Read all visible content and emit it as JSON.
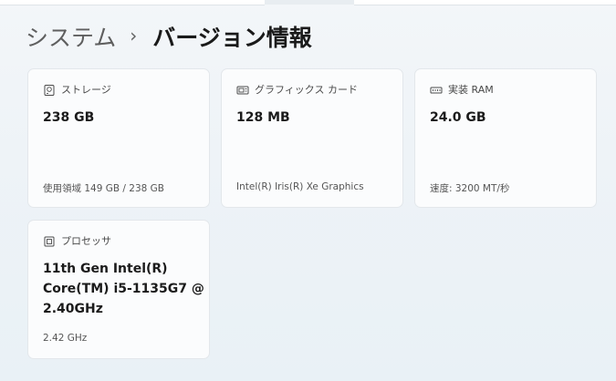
{
  "breadcrumb": {
    "parent": "システム",
    "separator": "›",
    "current": "バージョン情報"
  },
  "cards": {
    "storage": {
      "icon": "storage-icon",
      "label": "ストレージ",
      "value": "238 GB",
      "detail": "使用領域 149 GB / 238 GB"
    },
    "graphics": {
      "icon": "graphics-card-icon",
      "label": "グラフィックス カード",
      "value": "128 MB",
      "detail": "Intel(R) Iris(R) Xe Graphics"
    },
    "ram": {
      "icon": "memory-icon",
      "label": "実装 RAM",
      "value": "24.0 GB",
      "detail": "速度: 3200 MT/秒"
    },
    "processor": {
      "icon": "processor-icon",
      "label": "プロセッサ",
      "value_lines": [
        "11th Gen Intel(R)",
        "Core(TM) i5-1135G7 @",
        "2.40GHz"
      ],
      "detail": "2.42 GHz"
    }
  }
}
